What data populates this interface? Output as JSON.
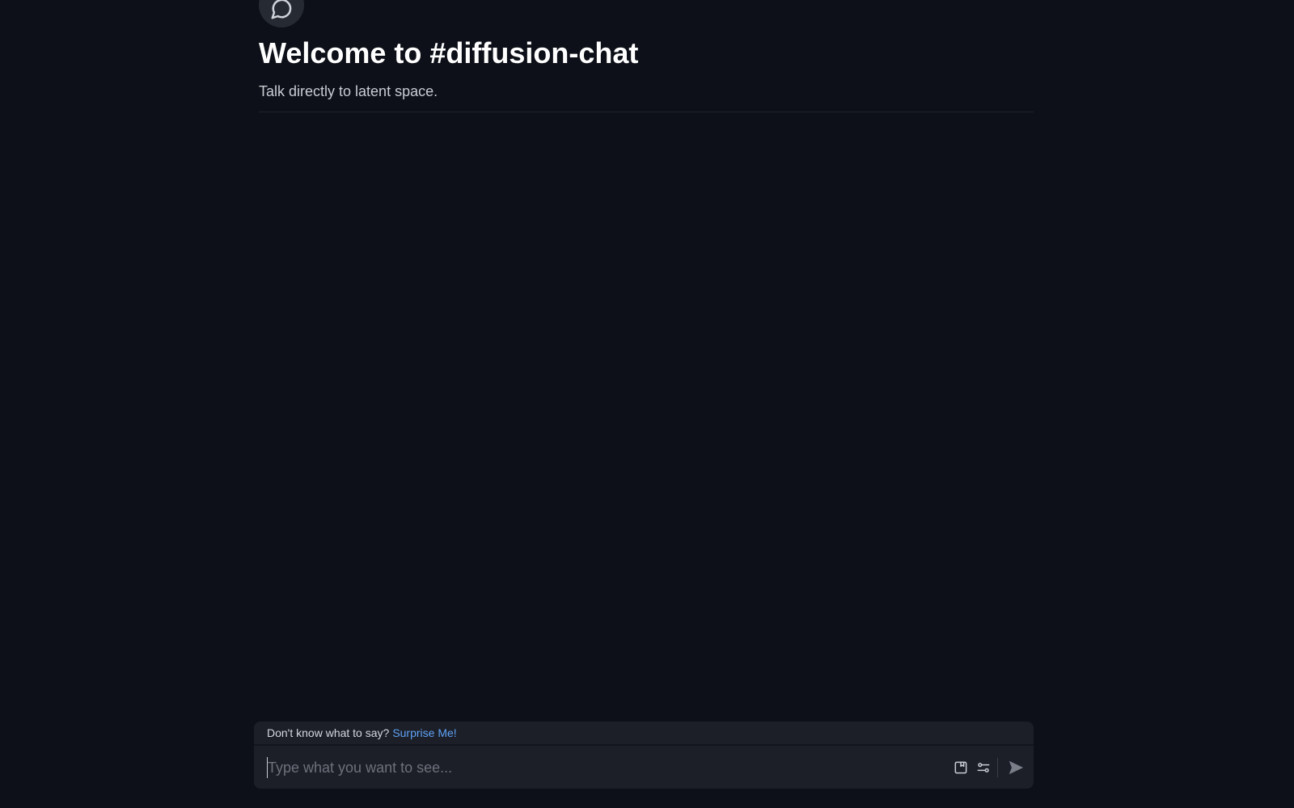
{
  "channel": {
    "icon": "chat-bubble-icon",
    "title": "Welcome to #diffusion-chat",
    "subtitle": "Talk directly to latent space."
  },
  "composer": {
    "suggestion_text": "Don't know what to say?",
    "surprise_label": "Surprise Me!",
    "input_value": "",
    "input_placeholder": "Type what you want to see...",
    "save_icon": "save-icon",
    "settings_icon": "sliders-icon",
    "send_icon": "send-icon"
  },
  "colors": {
    "background": "#0d1018",
    "composer_bg": "#1c1f28",
    "link": "#5fa2f5",
    "title": "#ffffff",
    "subtitle": "#c9ccd3"
  }
}
